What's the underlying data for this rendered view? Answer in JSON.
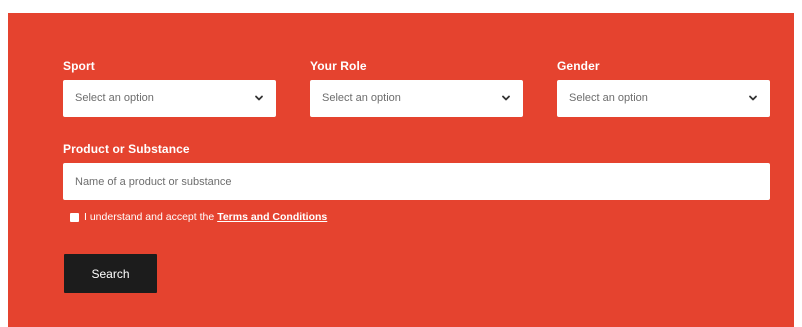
{
  "form": {
    "sport": {
      "label": "Sport",
      "placeholder": "Select an option",
      "icon": "chevron-down-icon"
    },
    "role": {
      "label": "Your Role",
      "placeholder": "Select an option",
      "icon": "chevron-down-icon"
    },
    "gender": {
      "label": "Gender",
      "placeholder": "Select an option",
      "icon": "chevron-down-icon"
    },
    "product": {
      "label": "Product or Substance",
      "placeholder": "Name of a product or substance",
      "value": ""
    },
    "terms": {
      "text": "I understand and accept the",
      "link_text": "Terms and Conditions",
      "checked": false
    },
    "search_label": "Search"
  },
  "colors": {
    "panel_background": "#e5432f",
    "button_background": "#1c1c1c",
    "text_on_panel": "#ffffff"
  }
}
